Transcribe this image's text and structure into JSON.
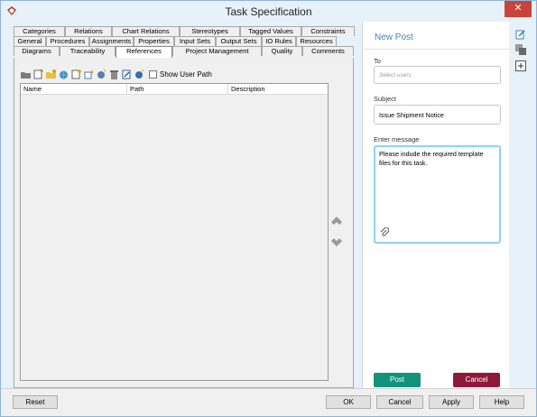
{
  "window": {
    "title": "Task Specification",
    "close_label": "✕"
  },
  "tabs": {
    "row1": [
      "Categories",
      "Relations",
      "Chart Relations",
      "Stereotypes",
      "Tagged Values",
      "Constraints"
    ],
    "row2": [
      "General",
      "Procedures",
      "Assignments",
      "Properties",
      "Input Sets",
      "Output Sets",
      "IO Rules",
      "Resources"
    ],
    "row3": [
      "Diagrams",
      "Traceability",
      "References",
      "Project Management",
      "Quality",
      "Comments"
    ],
    "active": "References"
  },
  "toolbar": {
    "show_user_path_label": "Show User Path",
    "icons": [
      "folder-icon",
      "new-file-icon",
      "new-folder-icon",
      "url-icon",
      "new-document-icon",
      "model-element-icon",
      "shape-icon",
      "delete-icon",
      "edit-icon",
      "open-icon"
    ]
  },
  "table": {
    "columns": [
      "Name",
      "Path",
      "Description"
    ]
  },
  "post": {
    "title": "New Post",
    "to_label": "To",
    "to_placeholder": "Select users",
    "subject_label": "Subject",
    "subject_value": "Issue Shipment Notice",
    "message_label": "Enter message",
    "message_value": "Please indude the required template files for this task.",
    "post_button": "Post",
    "cancel_button": "Cancel"
  },
  "footer": {
    "reset": "Reset",
    "ok": "OK",
    "cancel": "Cancel",
    "apply": "Apply",
    "help": "Help"
  },
  "colors": {
    "title_bg": "#e6f1fa",
    "close_red": "#c7443a",
    "post_green": "#13937b",
    "cancel_maroon": "#8e1a3b",
    "accent_blue": "#4a7fb0"
  }
}
